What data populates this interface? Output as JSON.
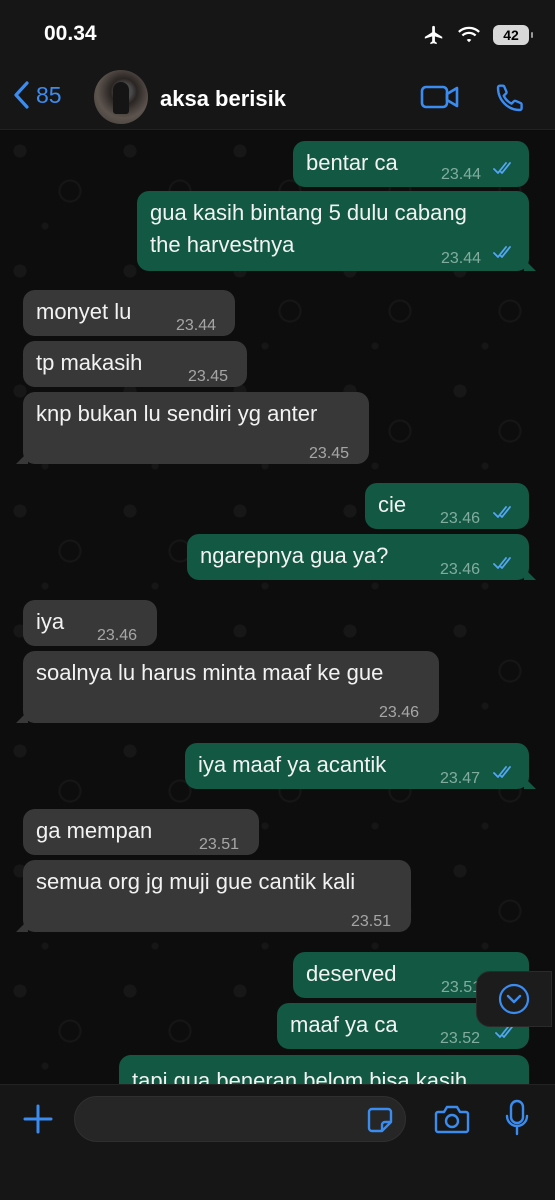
{
  "status_bar": {
    "time": "00.34",
    "battery": "42"
  },
  "header": {
    "back_count": "85",
    "contact_name": "aksa berisik"
  },
  "messages": [
    {
      "dir": "out",
      "text": "bentar ca",
      "time": "23.44",
      "read": true
    },
    {
      "dir": "out",
      "text": "gua kasih bintang 5 dulu cabang",
      "text2": "the harvestnya",
      "time": "23.44",
      "read": true
    },
    {
      "dir": "in",
      "text": "monyet lu",
      "time": "23.44"
    },
    {
      "dir": "in",
      "text": "tp makasih",
      "time": "23.45"
    },
    {
      "dir": "in",
      "text": "knp bukan lu sendiri yg anter",
      "time": "23.45"
    },
    {
      "dir": "out",
      "text": "cie",
      "time": "23.46",
      "read": true
    },
    {
      "dir": "out",
      "text": "ngarepnya gua ya?",
      "time": "23.46",
      "read": true
    },
    {
      "dir": "in",
      "text": "iya",
      "time": "23.46"
    },
    {
      "dir": "in",
      "text": "soalnya lu harus minta maaf ke gue",
      "time": "23.46"
    },
    {
      "dir": "out",
      "text": "iya maaf ya acantik",
      "time": "23.47",
      "read": true
    },
    {
      "dir": "in",
      "text": "ga mempan",
      "time": "23.51"
    },
    {
      "dir": "in",
      "text": "semua org jg muji gue cantik kali",
      "time": "23.51"
    },
    {
      "dir": "out",
      "text": "deserved",
      "time": "23.51",
      "read": true
    },
    {
      "dir": "out",
      "text": "maaf ya ca",
      "time": "23.52",
      "read": true
    },
    {
      "dir": "out",
      "text": "tapi gua beneran belom bisa kasih",
      "time": "",
      "read": false
    }
  ],
  "input": {
    "placeholder": ""
  },
  "colors": {
    "accent": "#3b8cf0",
    "outgoing_bubble": "#125843",
    "incoming_bubble": "#383838",
    "read_ticks": "#53a6f2"
  },
  "icons": [
    "back-chevron-icon",
    "video-call-icon",
    "phone-icon",
    "plus-icon",
    "sticker-icon",
    "camera-icon",
    "mic-icon",
    "chevron-down-icon",
    "airplane-icon",
    "wifi-icon",
    "battery-icon",
    "double-check-icon"
  ]
}
